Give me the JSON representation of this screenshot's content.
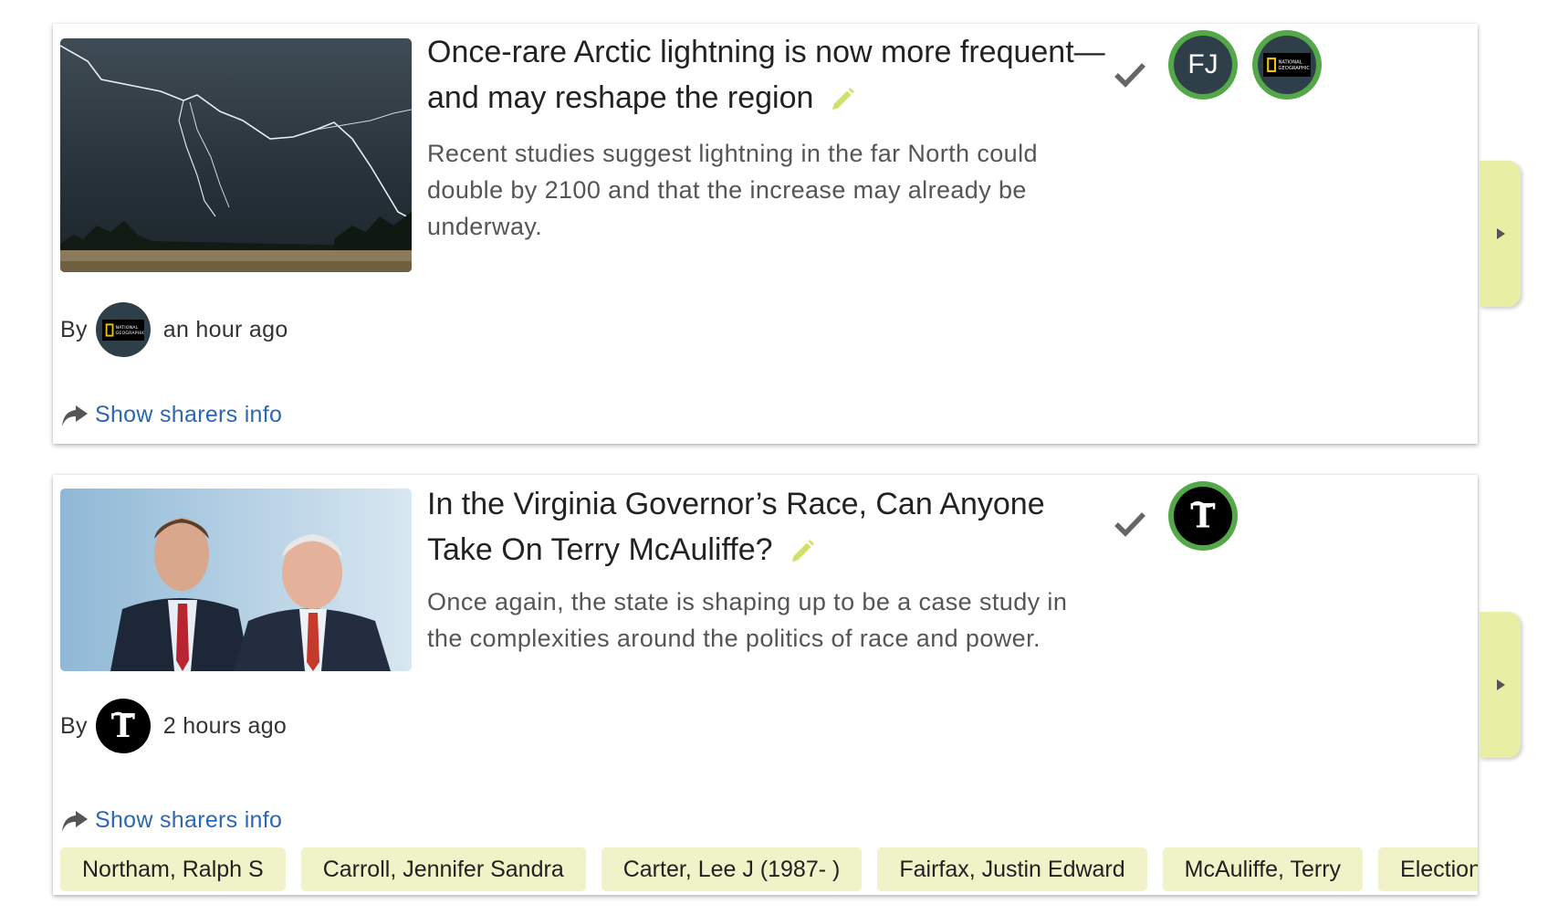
{
  "colors": {
    "sharer_ring": "#55a84a",
    "link": "#2a67b4",
    "edit_pencil": "#d2e06a",
    "expand_tab": "#e8eea3",
    "tag_bg": "#f0f2c8"
  },
  "articles": [
    {
      "headline": "Once-rare Arctic lightning is now more frequent—and may reshape the region",
      "description": "Recent studies suggest lightning in the far North could double by 2100 and that the increase may already be underway.",
      "image_icon": "lightning-storm-photo",
      "sharers": [
        {
          "initials": "FJ",
          "icon": "initials-avatar"
        },
        {
          "icon": "national-geographic-logo"
        }
      ],
      "byline": {
        "prefix": "By",
        "source_icon": "national-geographic-logo",
        "time": "an hour ago"
      },
      "show_sharers_label": "Show sharers info",
      "tags": []
    },
    {
      "headline": "In the Virginia Governor’s Race, Can Anyone Take On Terry McAuliffe?",
      "description": "Once again, the state is shaping up to be a case study in the complexities around the politics of race and power.",
      "image_icon": "two-politicians-photo",
      "sharers": [
        {
          "icon": "new-york-times-logo"
        }
      ],
      "byline": {
        "prefix": "By",
        "source_icon": "new-york-times-logo",
        "time": "2 hours ago"
      },
      "show_sharers_label": "Show sharers info",
      "tags": [
        "Northam, Ralph S",
        "Carroll, Jennifer Sandra",
        "Carter, Lee J (1987- )",
        "Fairfax, Justin Edward",
        "McAuliffe, Terry",
        "Elections, Go"
      ]
    }
  ]
}
